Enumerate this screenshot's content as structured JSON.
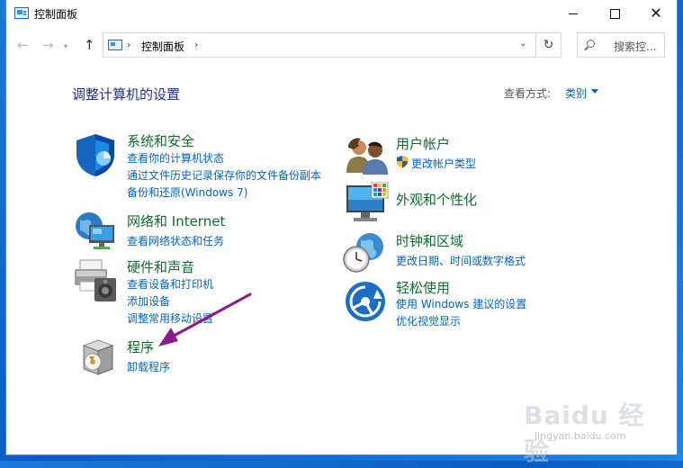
{
  "window": {
    "title": "控制面板"
  },
  "navbar": {
    "breadcrumb": "控制面板",
    "search_placeholder": "搜索控..."
  },
  "header": {
    "page_title": "调整计算机的设置",
    "view_by_label": "查看方式:",
    "view_by_value": "类别"
  },
  "categories": [
    {
      "title": "系统和安全",
      "links": [
        "查看你的计算机状态",
        "通过文件历史记录保存你的文件备份副本",
        "备份和还原(Windows 7)"
      ]
    },
    {
      "title": "网络和 Internet",
      "links": [
        "查看网络状态和任务"
      ]
    },
    {
      "title": "硬件和声音",
      "links": [
        "查看设备和打印机",
        "添加设备",
        "调整常用移动设置"
      ]
    },
    {
      "title": "程序",
      "links": [
        "卸载程序"
      ]
    },
    {
      "title": "用户帐户",
      "links": [
        "更改帐户类型"
      ]
    },
    {
      "title": "外观和个性化",
      "links": []
    },
    {
      "title": "时钟和区域",
      "links": [
        "更改日期、时间或数字格式"
      ]
    },
    {
      "title": "轻松使用",
      "links": [
        "使用 Windows 建议的设置",
        "优化视觉显示"
      ]
    }
  ],
  "watermark": {
    "main": "Baidu 经验",
    "sub": "jingyan.baidu.com"
  },
  "colors": {
    "category_title": "#0f6e2e",
    "link": "#0066cc",
    "page_title": "#1e3287",
    "annotation_arrow": "#8a1c8a"
  }
}
